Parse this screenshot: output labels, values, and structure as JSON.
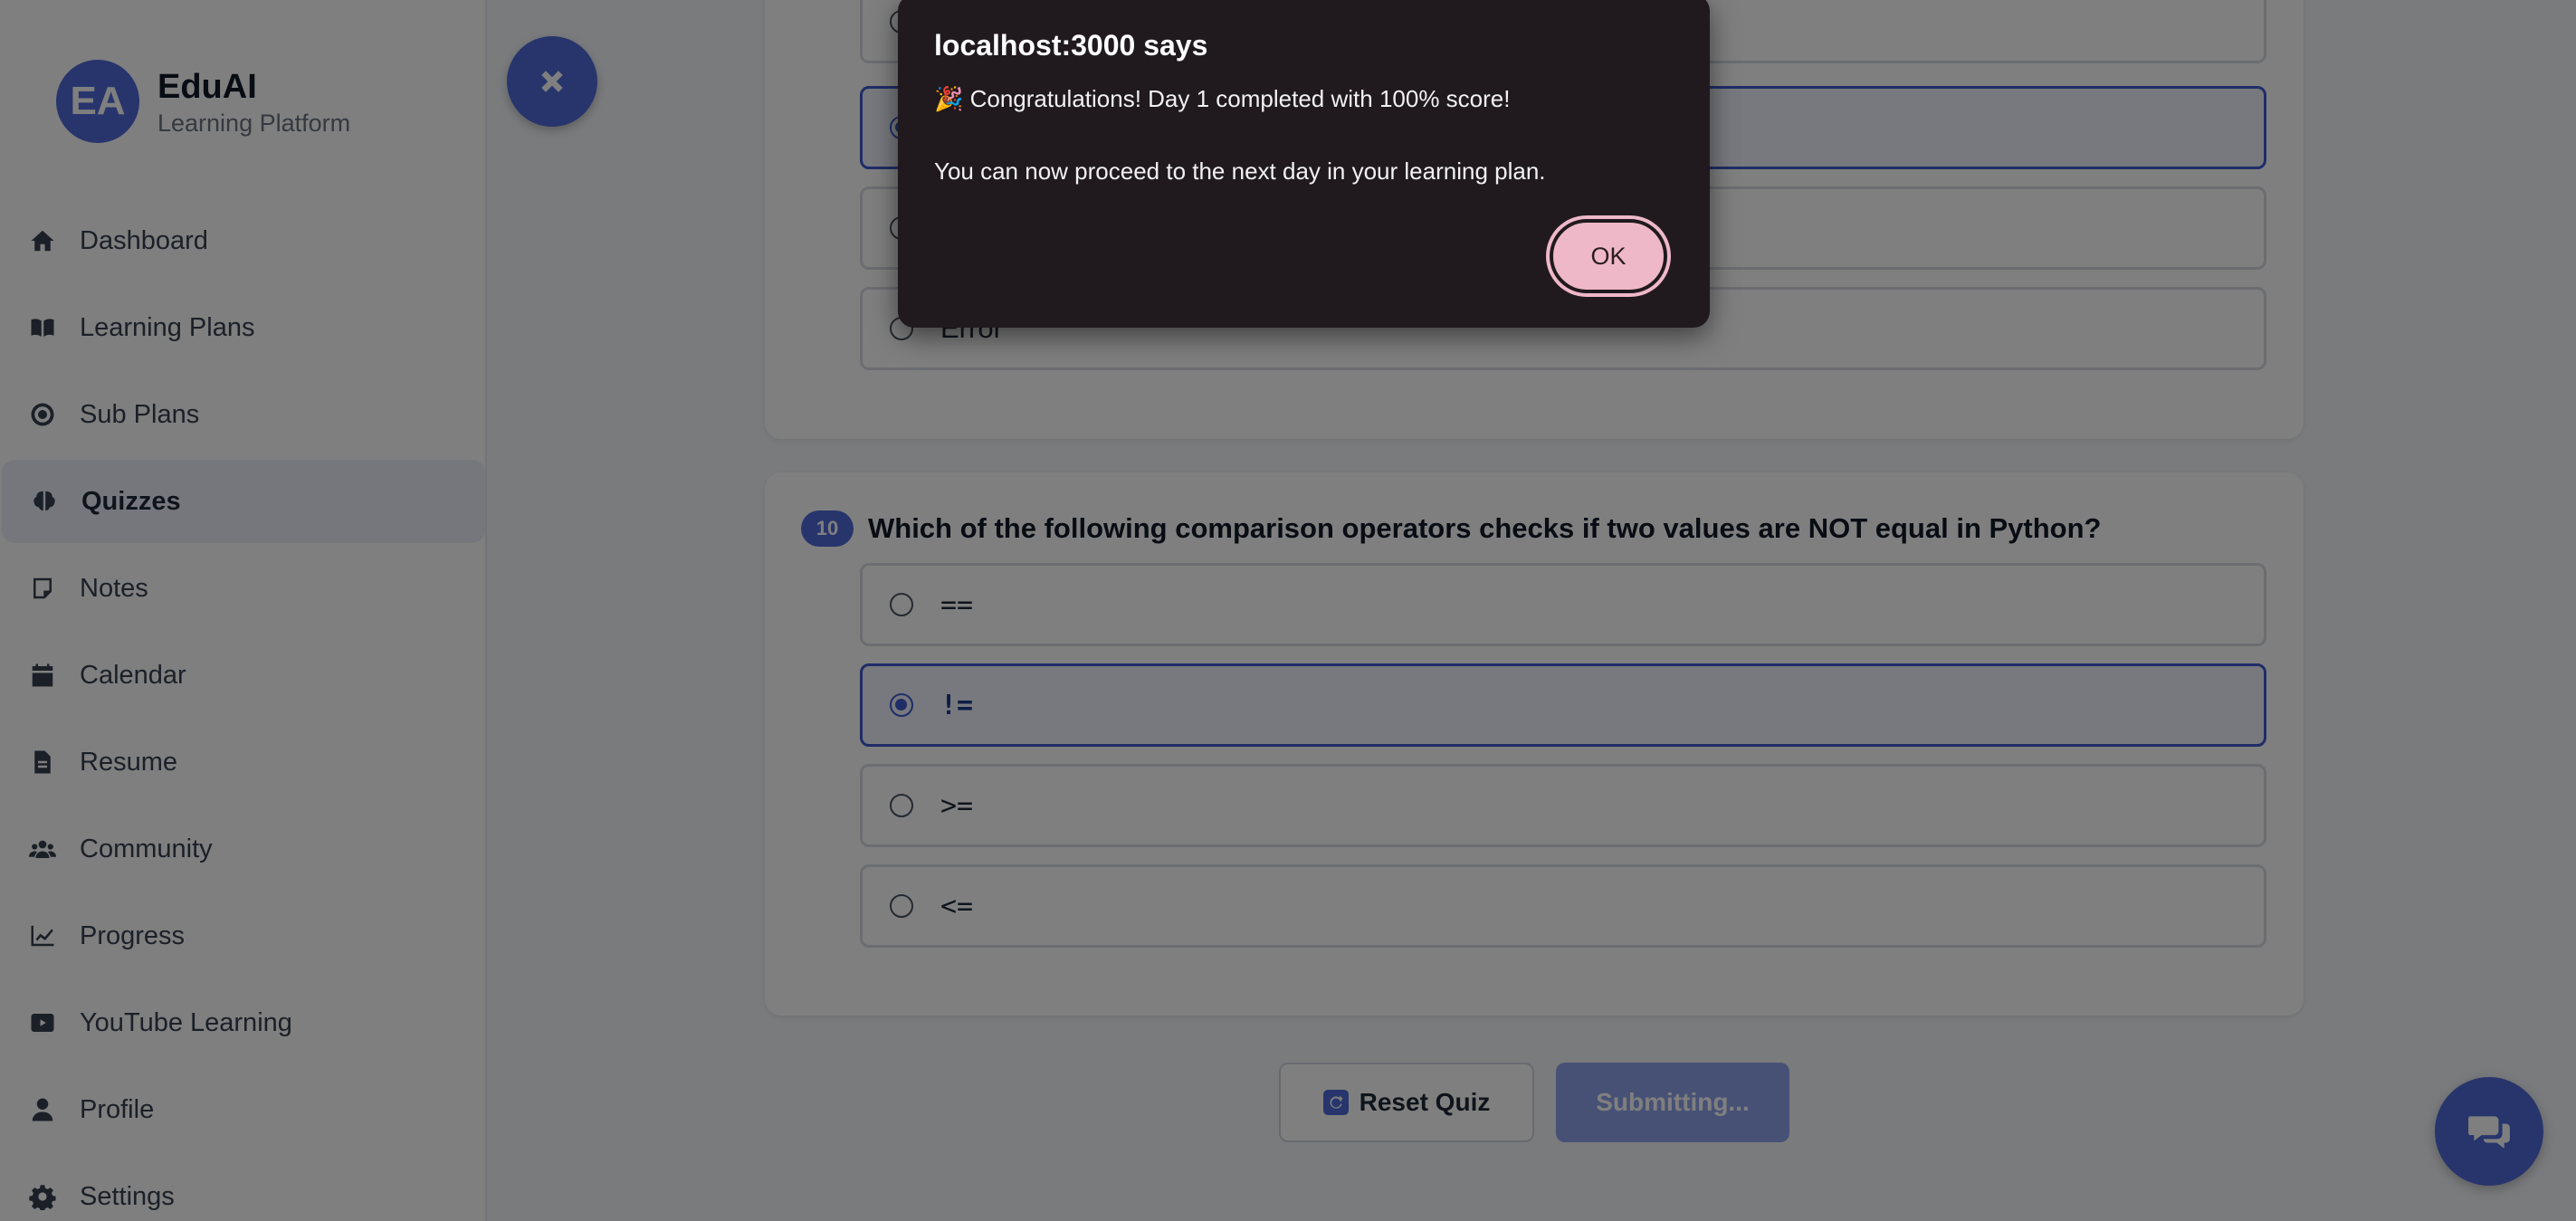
{
  "brand": {
    "initials": "EA",
    "name": "EduAI",
    "subtitle": "Learning Platform"
  },
  "sidebar": {
    "items": [
      {
        "label": "Dashboard",
        "icon": "home-icon"
      },
      {
        "label": "Learning Plans",
        "icon": "book-icon"
      },
      {
        "label": "Sub Plans",
        "icon": "target-icon"
      },
      {
        "label": "Quizzes",
        "icon": "brain-icon",
        "active": true
      },
      {
        "label": "Notes",
        "icon": "note-icon"
      },
      {
        "label": "Calendar",
        "icon": "calendar-icon"
      },
      {
        "label": "Resume",
        "icon": "document-icon"
      },
      {
        "label": "Community",
        "icon": "users-icon"
      },
      {
        "label": "Progress",
        "icon": "chart-line-icon"
      },
      {
        "label": "YouTube Learning",
        "icon": "youtube-icon"
      },
      {
        "label": "Profile",
        "icon": "user-icon"
      },
      {
        "label": "Settings",
        "icon": "gear-icon"
      }
    ]
  },
  "prev_question": {
    "last_option": "Error"
  },
  "question10": {
    "number": "10",
    "text": "Which of the following comparison operators checks if two values are NOT equal in Python?",
    "options": [
      {
        "label": "==",
        "selected": false
      },
      {
        "label": "!=",
        "selected": true
      },
      {
        "label": ">=",
        "selected": false
      },
      {
        "label": "<=",
        "selected": false
      }
    ]
  },
  "actions": {
    "reset_label": "Reset Quiz",
    "submit_label": "Submitting..."
  },
  "dialog": {
    "title": "localhost:3000 says",
    "message_line1": "🎉 Congratulations! Day 1 completed with 100% score!",
    "message_line2": "You can now proceed to the next day in your learning plan.",
    "ok_label": "OK"
  },
  "colors": {
    "accent": "#4f6bd8",
    "dialog_bg": "#201a1e",
    "ok_button": "#efb8c8"
  }
}
